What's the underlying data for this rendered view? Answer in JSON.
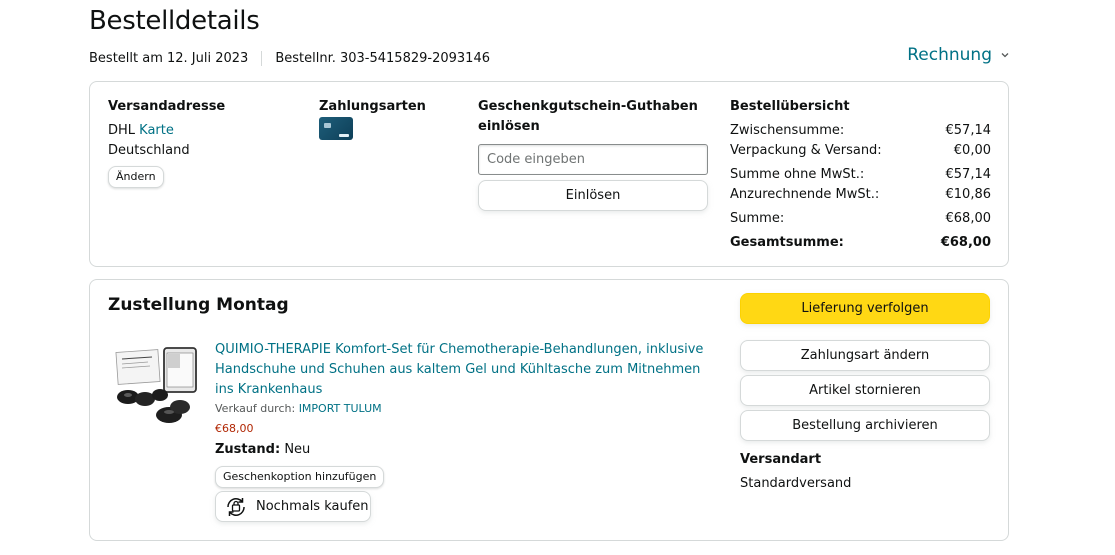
{
  "header": {
    "title": "Bestelldetails",
    "ordered_on": "Bestellt am 12. Juli 2023",
    "order_number": "Bestellnr. 303-5415829-2093146",
    "invoice_label": "Rechnung"
  },
  "summary_box": {
    "address": {
      "heading": "Versandadresse",
      "line1_prefix": "DHL",
      "line1_link": "Karte",
      "line2": "Deutschland",
      "change_label": "Ändern"
    },
    "payment": {
      "heading": "Zahlungsarten",
      "card_icon": "credit-card-icon"
    },
    "gift_card": {
      "heading_line1": "Geschenkgutschein-Guthaben",
      "heading_line2": "einlösen",
      "input_placeholder": "Code eingeben",
      "redeem_label": "Einlösen"
    },
    "order_summary": {
      "heading": "Bestellübersicht",
      "rows": [
        {
          "label": "Zwischensumme:",
          "value": "€57,14"
        },
        {
          "label": "Verpackung & Versand:",
          "value": "€0,00"
        },
        {
          "label": "Summe ohne MwSt.:",
          "value": "€57,14"
        },
        {
          "label": "Anzurechnende MwSt.:",
          "value": "€10,86"
        },
        {
          "label": "Summe:",
          "value": "€68,00"
        },
        {
          "label": "Gesamtsumme:",
          "value": "€68,00"
        }
      ]
    }
  },
  "shipment": {
    "heading": "Zustellung Montag",
    "product": {
      "title": "QUIMIO-THERAPIE Komfort-Set für Chemotherapie-Behandlungen, inklusive Handschuhe und Schuhen aus kaltem Gel und Kühltasche zum Mitnehmen ins Krankenhaus",
      "seller_prefix": "Verkauf durch:",
      "seller_name": "IMPORT TULUM",
      "price": "€68,00",
      "condition_label": "Zustand:",
      "condition_value": "Neu",
      "gift_option_label": "Geschenkoption hinzufügen",
      "buy_again_label": "Nochmals kaufen"
    },
    "actions": {
      "track": "Lieferung verfolgen",
      "change_payment": "Zahlungsart ändern",
      "cancel_items": "Artikel stornieren",
      "archive_order": "Bestellung archivieren"
    },
    "shipping_method": {
      "heading": "Versandart",
      "value": "Standardversand"
    }
  },
  "colors": {
    "link": "#007185",
    "price": "#b12704",
    "primary_button": "#ffd814",
    "border": "#d5d9d9"
  }
}
